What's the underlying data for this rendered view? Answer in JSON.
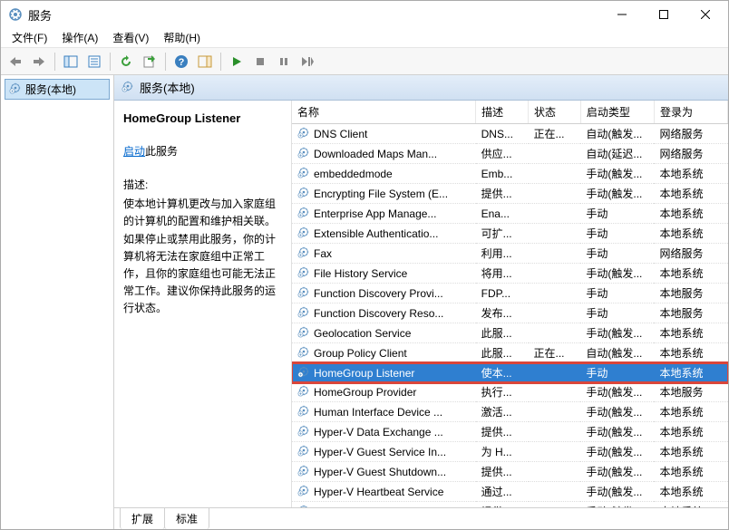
{
  "window": {
    "title": "服务"
  },
  "menu": {
    "file": "文件(F)",
    "action": "操作(A)",
    "view": "查看(V)",
    "help": "帮助(H)"
  },
  "tree": {
    "root": "服务(本地)"
  },
  "paneHeader": "服务(本地)",
  "detail": {
    "name": "HomeGroup Listener",
    "startLink": "启动",
    "startSuffix": "此服务",
    "descLabel": "描述:",
    "desc": "使本地计算机更改与加入家庭组的计算机的配置和维护相关联。如果停止或禁用此服务，你的计算机将无法在家庭组中正常工作，且你的家庭组也可能无法正常工作。建议你保持此服务的运行状态。"
  },
  "cols": {
    "name": "名称",
    "desc": "描述",
    "status": "状态",
    "startup": "启动类型",
    "logon": "登录为"
  },
  "rows": [
    {
      "name": "DNS Client",
      "desc": "DNS...",
      "status": "正在...",
      "startup": "自动(触发...",
      "logon": "网络服务"
    },
    {
      "name": "Downloaded Maps Man...",
      "desc": "供应...",
      "status": "",
      "startup": "自动(延迟...",
      "logon": "网络服务"
    },
    {
      "name": "embeddedmode",
      "desc": "Emb...",
      "status": "",
      "startup": "手动(触发...",
      "logon": "本地系统"
    },
    {
      "name": "Encrypting File System (E...",
      "desc": "提供...",
      "status": "",
      "startup": "手动(触发...",
      "logon": "本地系统"
    },
    {
      "name": "Enterprise App Manage...",
      "desc": "Ena...",
      "status": "",
      "startup": "手动",
      "logon": "本地系统"
    },
    {
      "name": "Extensible Authenticatio...",
      "desc": "可扩...",
      "status": "",
      "startup": "手动",
      "logon": "本地系统"
    },
    {
      "name": "Fax",
      "desc": "利用...",
      "status": "",
      "startup": "手动",
      "logon": "网络服务"
    },
    {
      "name": "File History Service",
      "desc": "将用...",
      "status": "",
      "startup": "手动(触发...",
      "logon": "本地系统"
    },
    {
      "name": "Function Discovery Provi...",
      "desc": "FDP...",
      "status": "",
      "startup": "手动",
      "logon": "本地服务"
    },
    {
      "name": "Function Discovery Reso...",
      "desc": "发布...",
      "status": "",
      "startup": "手动",
      "logon": "本地服务"
    },
    {
      "name": "Geolocation Service",
      "desc": "此服...",
      "status": "",
      "startup": "手动(触发...",
      "logon": "本地系统"
    },
    {
      "name": "Group Policy Client",
      "desc": "此服...",
      "status": "正在...",
      "startup": "自动(触发...",
      "logon": "本地系统"
    },
    {
      "name": "HomeGroup Listener",
      "desc": "使本...",
      "status": "",
      "startup": "手动",
      "logon": "本地系统",
      "selected": true,
      "highlight": true
    },
    {
      "name": "HomeGroup Provider",
      "desc": "执行...",
      "status": "",
      "startup": "手动(触发...",
      "logon": "本地服务"
    },
    {
      "name": "Human Interface Device ...",
      "desc": "激活...",
      "status": "",
      "startup": "手动(触发...",
      "logon": "本地系统"
    },
    {
      "name": "Hyper-V Data Exchange ...",
      "desc": "提供...",
      "status": "",
      "startup": "手动(触发...",
      "logon": "本地系统"
    },
    {
      "name": "Hyper-V Guest Service In...",
      "desc": "为 H...",
      "status": "",
      "startup": "手动(触发...",
      "logon": "本地系统"
    },
    {
      "name": "Hyper-V Guest Shutdown...",
      "desc": "提供...",
      "status": "",
      "startup": "手动(触发...",
      "logon": "本地系统"
    },
    {
      "name": "Hyper-V Heartbeat Service",
      "desc": "通过...",
      "status": "",
      "startup": "手动(触发...",
      "logon": "本地系统"
    },
    {
      "name": "Hyper-V Remote Deskto...",
      "desc": "提供...",
      "status": "",
      "startup": "手动(触发...",
      "logon": "本地系统"
    }
  ],
  "tabs": {
    "extended": "扩展",
    "standard": "标准"
  }
}
